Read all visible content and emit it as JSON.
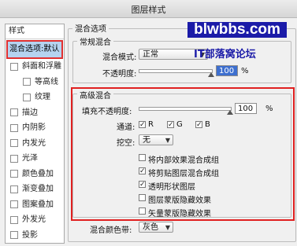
{
  "window": {
    "title": "图层样式"
  },
  "sidebar": {
    "header": "样式",
    "selected": "混合选项:默认",
    "items": [
      {
        "label": "斜面和浮雕",
        "indent": 1
      },
      {
        "label": "等高线",
        "indent": 2
      },
      {
        "label": "纹理",
        "indent": 2
      },
      {
        "label": "描边",
        "indent": 1
      },
      {
        "label": "内阴影",
        "indent": 1
      },
      {
        "label": "内发光",
        "indent": 1
      },
      {
        "label": "光泽",
        "indent": 1
      },
      {
        "label": "颜色叠加",
        "indent": 1
      },
      {
        "label": "渐变叠加",
        "indent": 1
      },
      {
        "label": "图案叠加",
        "indent": 1
      },
      {
        "label": "外发光",
        "indent": 1
      },
      {
        "label": "投影",
        "indent": 1
      }
    ]
  },
  "blend_options": {
    "title": "混合选项",
    "general": {
      "title": "常规混合",
      "mode_label": "混合模式:",
      "mode_value": "正常",
      "opacity_label": "不透明度:",
      "opacity_value": "100",
      "opacity_unit": "%"
    },
    "advanced": {
      "title": "高级混合",
      "fill_label": "填充不透明度:",
      "fill_value": "100",
      "fill_unit": "%",
      "channels_label": "通道:",
      "channel_r": "R",
      "channel_g": "G",
      "channel_b": "B",
      "knockout_label": "挖空:",
      "knockout_value": "无",
      "options": [
        {
          "label": "将内部效果混合成组",
          "checked": false
        },
        {
          "label": "将剪贴图层混合成组",
          "checked": true
        },
        {
          "label": "透明形状图层",
          "checked": true
        },
        {
          "label": "图层蒙版隐藏效果",
          "checked": false
        },
        {
          "label": "矢量蒙版隐藏效果",
          "checked": false
        }
      ]
    },
    "blend_if": {
      "label": "混合颜色带:",
      "value": "灰色"
    }
  },
  "watermark": {
    "logo": "blwbbs.com",
    "caption": "IT部落窝论坛"
  }
}
